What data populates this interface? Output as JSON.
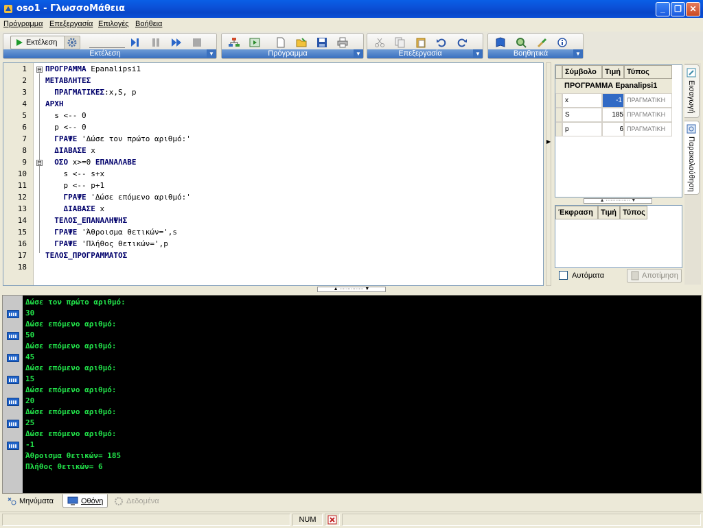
{
  "window": {
    "title": "oso1 - ΓλωσσοΜάθεια",
    "minimize": "_",
    "restore": "❐",
    "close": "✕"
  },
  "menu": [
    "Πρόγραμμα",
    "Επεξεργασία",
    "Επιλογές",
    "Βοήθεια"
  ],
  "toolbars": {
    "run_label": "Εκτέλεση",
    "group_captions": [
      "Εκτέλεση",
      "Πρόγραμμα",
      "Επεξεργασία",
      "Βοηθητικά"
    ]
  },
  "editor": {
    "line_numbers": [
      "1",
      "2",
      "3",
      "4",
      "5",
      "6",
      "7",
      "8",
      "9",
      "10",
      "11",
      "12",
      "13",
      "14",
      "15",
      "16",
      "17",
      "18"
    ],
    "lines": [
      [
        {
          "t": "ΠΡΟΓΡΑΜΜΑ",
          "k": 1
        },
        {
          "t": " Epanalipsi1",
          "k": 0
        }
      ],
      [
        {
          "t": "ΜΕΤΑΒΛΗΤΕΣ",
          "k": 1
        }
      ],
      [
        {
          "t": "  ΠΡΑΓΜΑΤΙΚΕΣ",
          "k": 1
        },
        {
          "t": ":x,S, p",
          "k": 0
        }
      ],
      [
        {
          "t": "ΑΡΧΗ",
          "k": 1
        }
      ],
      [
        {
          "t": "  s <-- 0",
          "k": 0
        }
      ],
      [
        {
          "t": "  p <-- 0",
          "k": 0
        }
      ],
      [
        {
          "t": "  ΓΡΑΨΕ",
          "k": 1
        },
        {
          "t": " 'Δώσε τον πρώτο αριθμό:'",
          "k": 0
        }
      ],
      [
        {
          "t": "  ΔΙΑΒΑΣΕ",
          "k": 1
        },
        {
          "t": " x",
          "k": 0
        }
      ],
      [
        {
          "t": "  ΟΣΟ",
          "k": 1
        },
        {
          "t": " x>=0 ",
          "k": 0
        },
        {
          "t": "ΕΠΑΝΑΛΑΒΕ",
          "k": 1
        }
      ],
      [
        {
          "t": "    s <-- s+x",
          "k": 0
        }
      ],
      [
        {
          "t": "    p <-- p+1",
          "k": 0
        }
      ],
      [
        {
          "t": "    ΓΡΑΨΕ",
          "k": 1
        },
        {
          "t": " 'Δώσε επόμενο αριθμό:'",
          "k": 0
        }
      ],
      [
        {
          "t": "    ΔΙΑΒΑΣΕ",
          "k": 1
        },
        {
          "t": " x",
          "k": 0
        }
      ],
      [
        {
          "t": "  ΤΕΛΟΣ_ΕΠΑΝΑΛΗΨΗΣ",
          "k": 1
        }
      ],
      [
        {
          "t": "  ΓΡΑΨΕ",
          "k": 1
        },
        {
          "t": " 'Άθροισμα θετικών=',s",
          "k": 0
        }
      ],
      [
        {
          "t": "  ΓΡΑΨΕ",
          "k": 1
        },
        {
          "t": " 'Πλήθος θετικών=',p",
          "k": 0
        }
      ],
      [
        {
          "t": "ΤΕΛΟΣ_ΠΡΟΓΡΑΜΜΑΤΟΣ",
          "k": 1
        }
      ],
      []
    ],
    "fold_markers": [
      "⊟",
      "⊟"
    ]
  },
  "symbols": {
    "headers": [
      "Σύμβολο",
      "Τιμή",
      "Τύπος"
    ],
    "program_row": "ΠΡΟΓΡΑΜΜΑ Epanalipsi1",
    "rows": [
      {
        "name": "x",
        "value": "-1",
        "type": "ΠΡΑΓΜΑΤΙΚΗ"
      },
      {
        "name": "S",
        "value": "185",
        "type": "ΠΡΑΓΜΑΤΙΚΗ"
      },
      {
        "name": "p",
        "value": "6",
        "type": "ΠΡΑΓΜΑΤΙΚΗ"
      }
    ]
  },
  "expressions": {
    "headers": [
      "Έκφραση",
      "Τιμή",
      "Τύπος"
    ]
  },
  "auto_label": "Αυτόματα",
  "evaluate_label": "Αποτίμηση",
  "side_tabs": [
    "Εισαγωγή",
    "Παρακολούθηση"
  ],
  "console": {
    "lines": [
      "Δώσε τον πρώτο αριθμό:",
      "30",
      "Δώσε επόμενο αριθμό:",
      "50",
      "Δώσε επόμενο αριθμό:",
      "45",
      "Δώσε επόμενο αριθμό:",
      "15",
      "Δώσε επόμενο αριθμό:",
      "20",
      "Δώσε επόμενο αριθμό:",
      "25",
      "Δώσε επόμενο αριθμό:",
      "-1",
      "Άθροισμα θετικών= 185",
      "Πλήθος θετικών= 6"
    ],
    "input_line_indices": [
      1,
      3,
      5,
      7,
      9,
      11,
      13
    ]
  },
  "bottom_tabs": [
    "Μηνύματα",
    "Οθόνη",
    "Δεδομένα"
  ],
  "status": {
    "num": "NUM"
  }
}
